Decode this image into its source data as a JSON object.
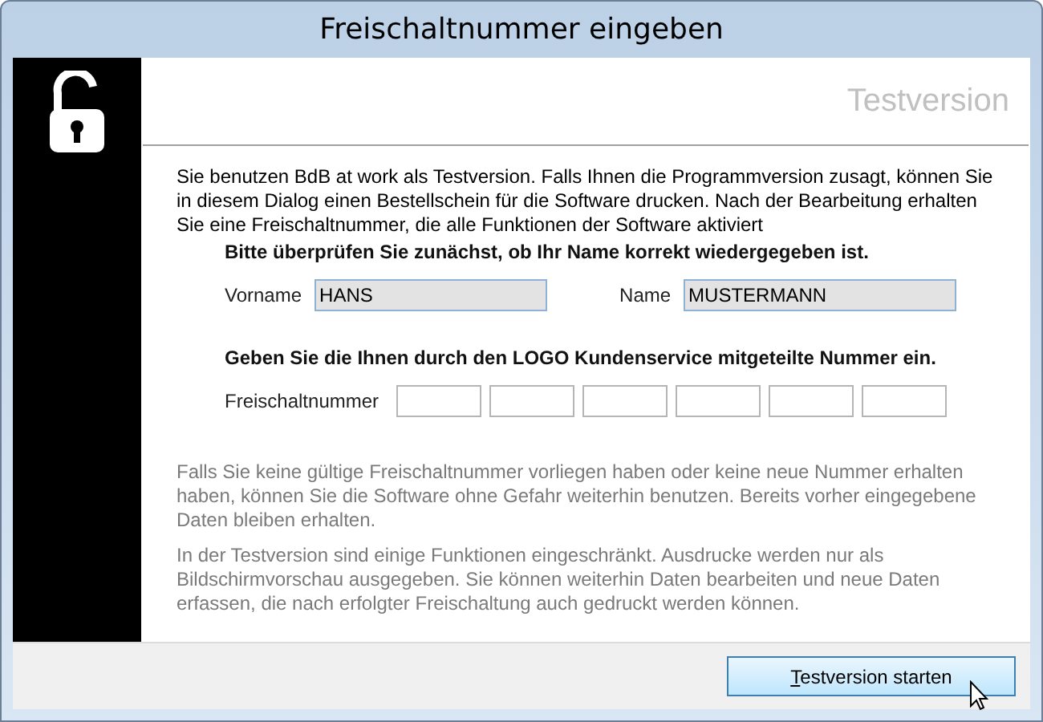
{
  "window": {
    "title": "Freischaltnummer eingeben"
  },
  "header": {
    "title": "Testversion"
  },
  "intro": "Sie benutzen BdB at work als Testversion. Falls Ihnen die Programmversion zusagt, können Sie in diesem Dialog einen Bestellschein für die Software drucken. Nach der Bearbeitung erhalten Sie eine Freischaltnummer, die alle Funktionen der Software aktiviert",
  "name_check": {
    "heading": "Bitte überprüfen Sie zunächst, ob Ihr Name korrekt wiedergegeben ist.",
    "fields": [
      {
        "label": "Vorname",
        "value": "HANS"
      },
      {
        "label": "Name",
        "value": "MUSTERMANN"
      }
    ]
  },
  "code": {
    "heading": "Geben Sie die Ihnen durch den LOGO Kundenservice mitgeteilte Nummer ein.",
    "label": "Freischaltnummer"
  },
  "notes": [
    "Falls Sie keine gültige Freischaltnummer vorliegen haben oder keine neue Nummer erhalten haben, können Sie die Software ohne Gefahr weiterhin benutzen. Bereits vorher eingegebene Daten bleiben erhalten.",
    "In der Testversion sind einige Funktionen eingeschränkt. Ausdrucke werden nur als Bildschirmvorschau ausgegeben. Sie können weiterhin Daten bearbeiten und neue Daten erfassen, die nach erfolgter Freischaltung auch gedruckt werden können."
  ],
  "buttons": [
    "Testversion starten"
  ]
}
